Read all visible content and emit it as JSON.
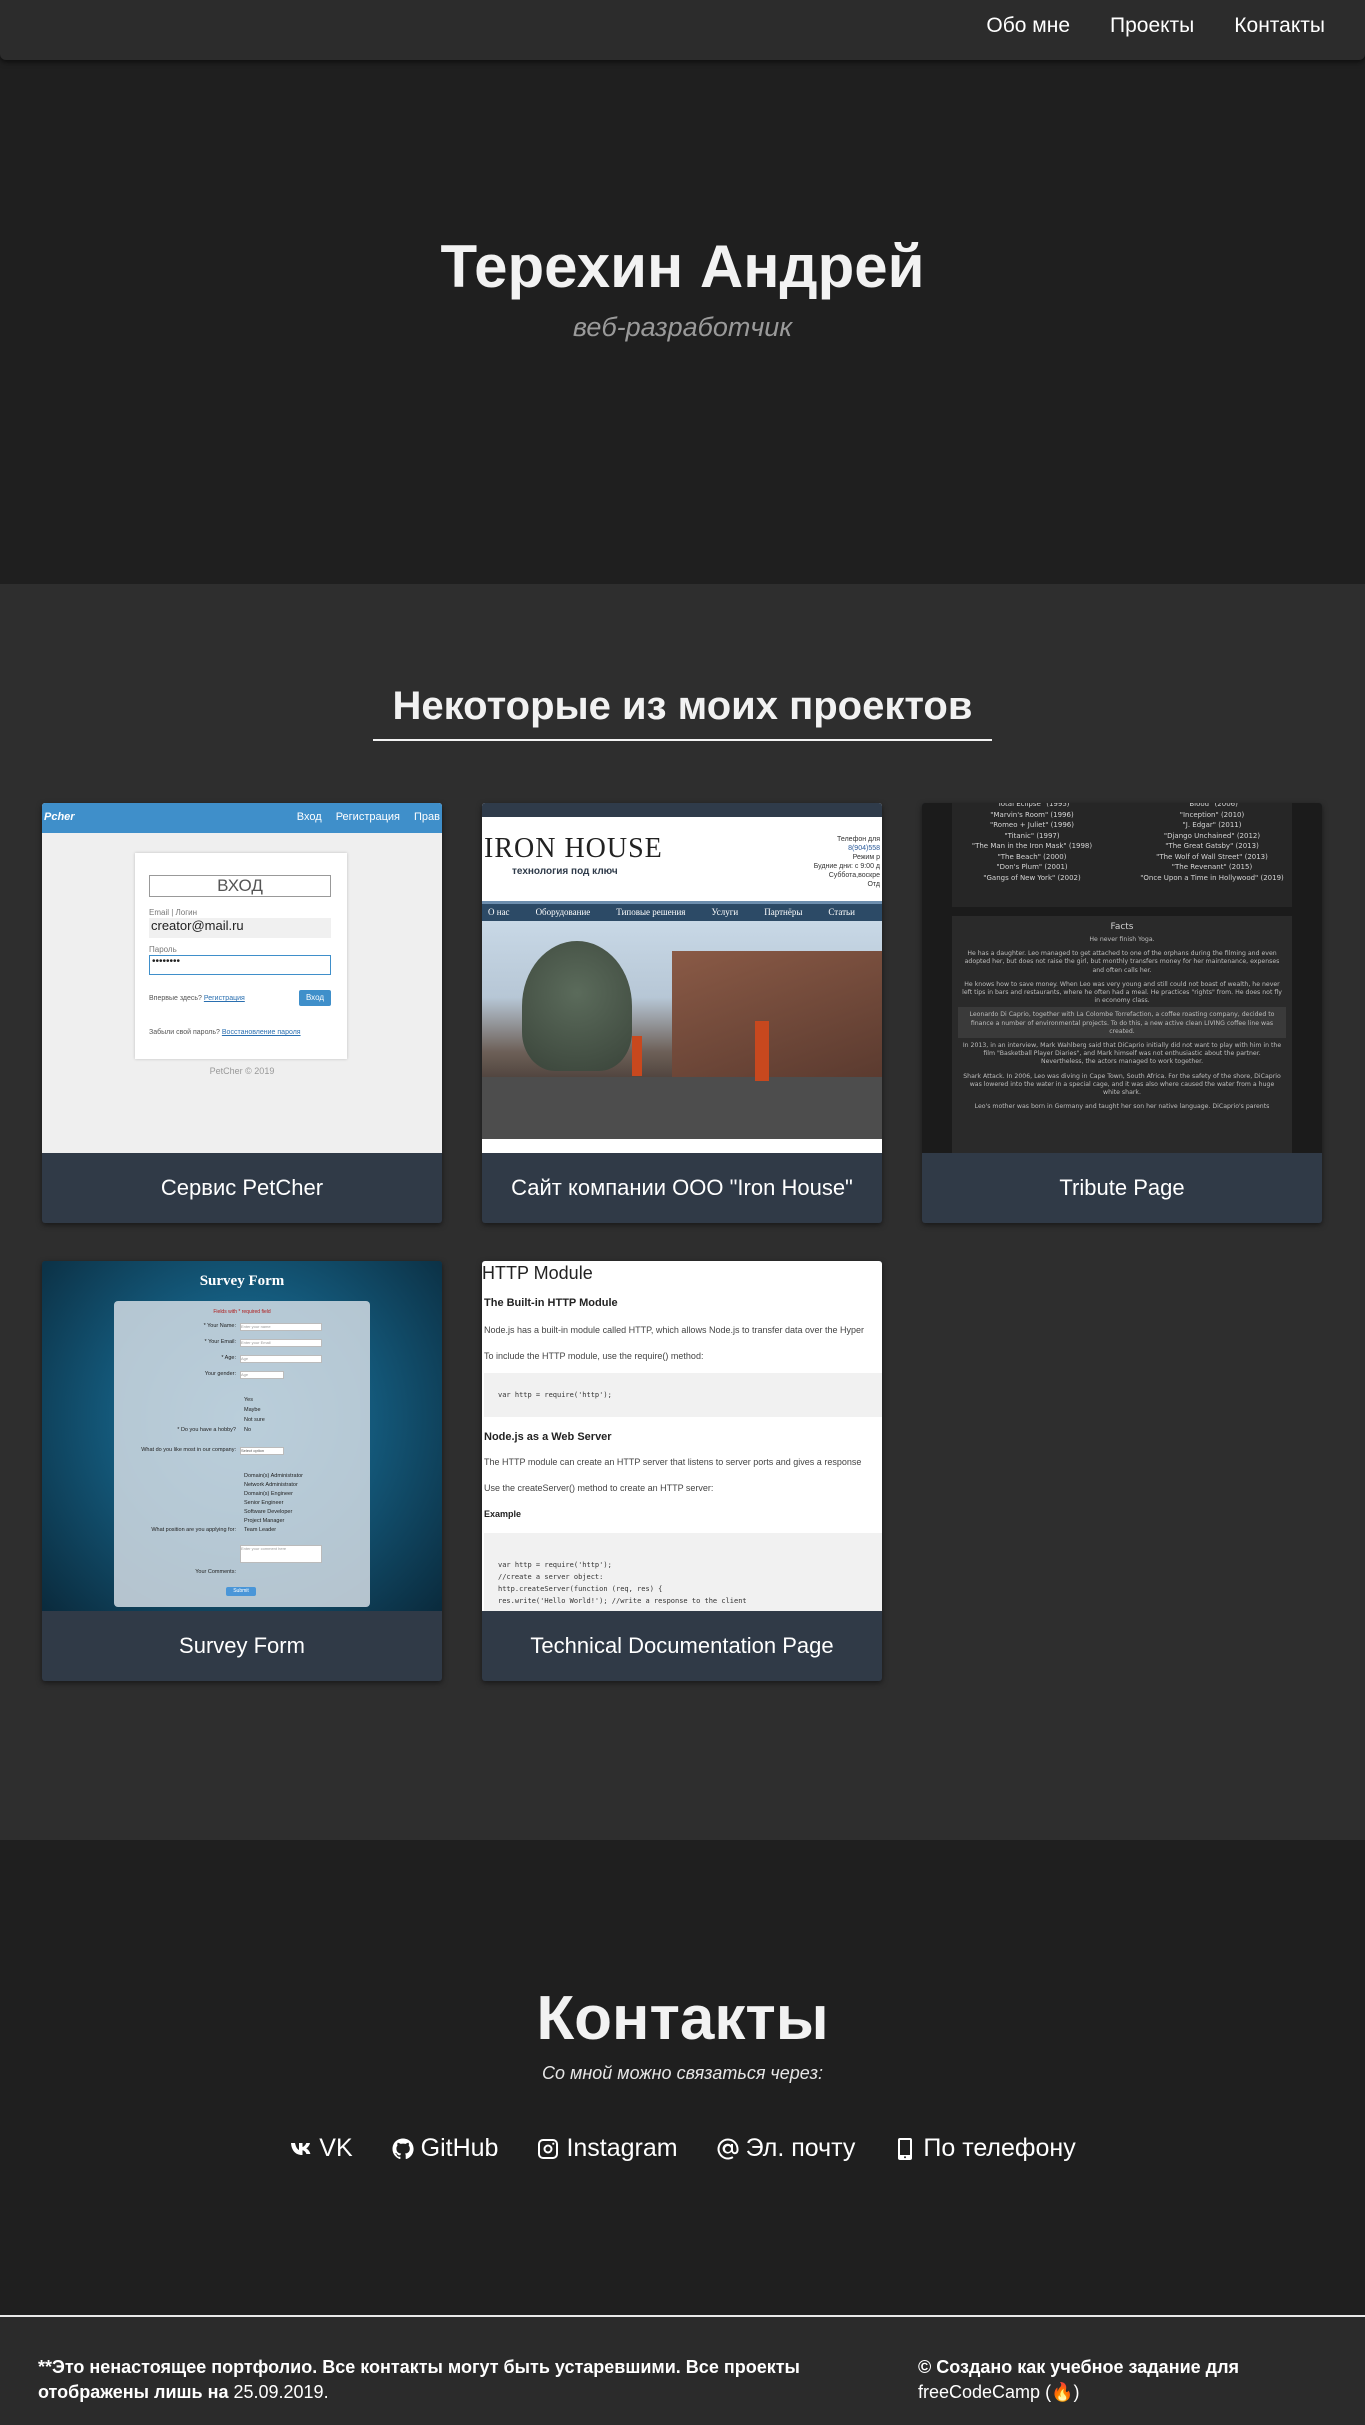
{
  "nav": {
    "items": [
      {
        "label": "Обо мне"
      },
      {
        "label": "Проекты"
      },
      {
        "label": "Контакты"
      }
    ]
  },
  "hero": {
    "name": "Терехин Андрей",
    "subtitle": "веб-разработчик"
  },
  "projects": {
    "title": "Некоторые из моих проектов",
    "items": [
      {
        "title": "Сервис PetCher"
      },
      {
        "title": "Сайт компании ООО \"Iron House\""
      },
      {
        "title": "Tribute Page"
      },
      {
        "title": "Survey Form"
      },
      {
        "title": "Technical Documentation Page"
      }
    ],
    "petcher": {
      "logo": "Pcher",
      "nav": [
        "Вход",
        "Регистрация",
        "Прав"
      ],
      "form_title": "ВХОД",
      "login_label": "Email | Логин",
      "login_value": "creator@mail.ru",
      "password_label": "Пароль",
      "password_value": "••••••••",
      "register_text": "Впервые здесь?",
      "register_link": "Регистрация",
      "submit": "Вход",
      "forgot_text": "Забыли свой пароль?",
      "forgot_link": "Восстановление пароля",
      "copyright": "PetCher © 2019"
    },
    "ironhouse": {
      "brand": "IRON HOUSE",
      "tagline": "технология под ключ",
      "contact_lines": [
        "Телефон для",
        "8(904)558",
        "Режим р",
        "Будние дни: с 9:00 д",
        "Суббота,воскре",
        "Отд"
      ],
      "menu": [
        "О нас",
        "Оборудование",
        "Типовые решения",
        "Услуги",
        "Партнёры",
        "Статьи"
      ]
    },
    "tribute": {
      "films_left": [
        "\"Total Eclipse\" (1995)",
        "\"Marvin's Room\" (1996)",
        "\"Romeo + Juliet\" (1996)",
        "\"Titanic\" (1997)",
        "\"The Man in the Iron Mask\" (1998)",
        "\"The Beach\" (2000)",
        "\"Don's Plum\" (2001)",
        "\"Gangs of New York\" (2002)"
      ],
      "films_right": [
        "\"Blood\" (2006)",
        "\"Inception\" (2010)",
        "\"J. Edgar\" (2011)",
        "\"Django Unchained\" (2012)",
        "\"The Great Gatsby\" (2013)",
        "\"The Wolf of Wall Street\" (2013)",
        "\"The Revenant\" (2015)",
        "\"Once Upon a Time in Hollywood\" (2019)"
      ],
      "facts_title": "Facts",
      "facts": [
        "He never finish Yoga.",
        "He has a daughter. Leo managed to get attached to one of the orphans during the filming and even adopted her, but does not raise the girl, but monthly transfers money for her maintenance, expenses and often calls her.",
        "He knows how to save money. When Leo was very young and still could not boast of wealth, he never left tips in bars and restaurants, where he often had a meal. He practices \"rights\" from. He does not fly in economy class.",
        "Leonardo Di Caprio, together with La Colombe Torrefaction, a coffee roasting company, decided to finance a number of environmental projects. To do this, a new active clean LIVING coffee line was created.",
        "In 2013, in an interview, Mark Wahlberg said that DiCaprio initially did not want to play with him in the film \"Basketball Player Diaries\", and Mark himself was not enthusiastic about the partner. Nevertheless, the actors managed to work together.",
        "Shark Attack. In 2006, Leo was diving in Cape Town, South Africa. For the safety of the shore, DiCaprio was lowered into the water in a special cage, and it was also where caused the water from a huge white shark.",
        "Leo's mother was born in Germany and taught her son her native language. DiCaprio's parents"
      ]
    },
    "survey": {
      "title": "Survey Form",
      "required": "Fields with * required field",
      "fields": [
        {
          "label": "* Your Name:",
          "value": "Enter your name"
        },
        {
          "label": "* Your Email:",
          "value": "Enter your Email"
        },
        {
          "label": "* Age:",
          "value": "Age"
        },
        {
          "label": "Your gender:",
          "value": "Age"
        }
      ],
      "q1": "* Do you have a hobby?",
      "q1_options": [
        "Yes",
        "Maybe",
        "Not sure",
        "No"
      ],
      "q2": "What do you like most in our company:",
      "q2_value": "Select option",
      "q3": "What position are you applying for:",
      "q3_options": [
        "Domain(s) Administrator",
        "Network Administrator",
        "Domain(s) Engineer",
        "Senior Engineer",
        "Software Developer",
        "Project Manager",
        "Team Leader"
      ],
      "comments_label": "Your Comments:",
      "comments_placeholder": "Enter your comment here",
      "submit": "Submit"
    },
    "techdoc": {
      "heading": "HTTP Module",
      "s1": "The Built-in HTTP Module",
      "p1": "Node.js has a built-in module called HTTP, which allows Node.js to transfer data over the Hyper",
      "p2": "To include the HTTP module, use the require() method:",
      "code1": "var http = require('http');",
      "s2": "Node.js as a Web Server",
      "p3": "The HTTP module can create an HTTP server that listens to server ports and gives a response",
      "p4": "Use the createServer() method to create an HTTP server:",
      "s3": "Example",
      "code2": [
        "var http = require('http');",
        "//create a server object:",
        "http.createServer(function (req, res) {",
        "  res.write('Hello World!'); //write a response to the client"
      ]
    }
  },
  "contacts": {
    "title": "Контакты",
    "subtitle": "Со мной можно связаться через:",
    "links": [
      {
        "label": "VK",
        "icon": "vk-icon"
      },
      {
        "label": "GitHub",
        "icon": "github-icon"
      },
      {
        "label": "Instagram",
        "icon": "instagram-icon"
      },
      {
        "label": "Эл. почту",
        "icon": "at-icon"
      },
      {
        "label": "По телефону",
        "icon": "phone-icon"
      }
    ]
  },
  "footer": {
    "disclaimer_prefix": "**Это ненастоящее портфолио. Все контакты могут быть устаревшими. Все проекты отображены лишь на ",
    "date": "25.09.2019.",
    "credit_prefix": "© Создано как учебное задание для ",
    "credit_link": "freeCodeCamp",
    "credit_icon": "(🔥)"
  },
  "colors": {
    "hero_bg": "#1f1f1f",
    "projects_bg": "#2e2e2e",
    "card_bg": "#303a47",
    "text": "#f2f2f2"
  }
}
